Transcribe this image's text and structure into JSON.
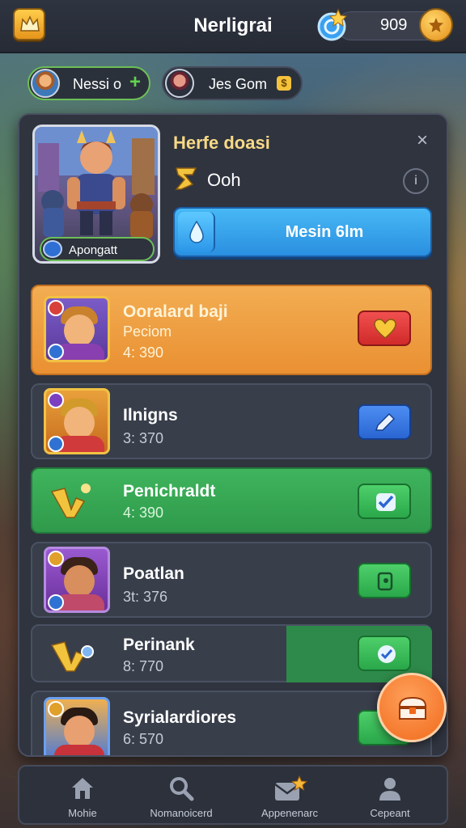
{
  "header": {
    "title": "Nerligrai",
    "currency_value": "909",
    "icons": [
      "crown-icon",
      "gem-icon",
      "coin-icon"
    ]
  },
  "players": [
    {
      "name": "Nessi o",
      "action": "+"
    },
    {
      "name": "Jes Gom",
      "badge": "$"
    }
  ],
  "detail": {
    "title": "Herfe doasi",
    "rank_label": "Ooh",
    "hero_tag": "Apongatt",
    "action_label": "Mesin 6lm",
    "close_symbol": "×",
    "info_symbol": "i"
  },
  "rows": [
    {
      "name": "Ooralard baji",
      "sub": "Peciom",
      "score": "4: 390",
      "style": "orange",
      "button": "heart-button"
    },
    {
      "name": "Ilnigns",
      "sub": "",
      "score": "3: 370",
      "style": "dark",
      "button": "edit-button"
    },
    {
      "name": "Penichraldt",
      "sub": "",
      "score": "4: 390",
      "style": "green",
      "button": "check-button"
    },
    {
      "name": "Poatlan",
      "sub": "",
      "score": "3t: 376",
      "style": "dark",
      "button": "card-button"
    },
    {
      "name": "Perinank",
      "sub": "",
      "score": "8: 770",
      "style": "dark",
      "button": "check-button"
    },
    {
      "name": "Syrialardiores",
      "sub": "",
      "score": "6: 570",
      "style": "dark",
      "button": "check-button"
    }
  ],
  "nav": [
    {
      "label": "Mohie",
      "icon": "home-icon"
    },
    {
      "label": "Nomanoicerd",
      "icon": "search-icon"
    },
    {
      "label": "Appenenarc",
      "icon": "mail-icon"
    },
    {
      "label": "Cepeant",
      "icon": "profile-icon"
    }
  ],
  "colors": {
    "accent_orange": "#e99032",
    "accent_green": "#2f9a4b",
    "accent_blue": "#2a8fe0",
    "panel": "#2f343f",
    "title_gold": "#f8d987"
  }
}
